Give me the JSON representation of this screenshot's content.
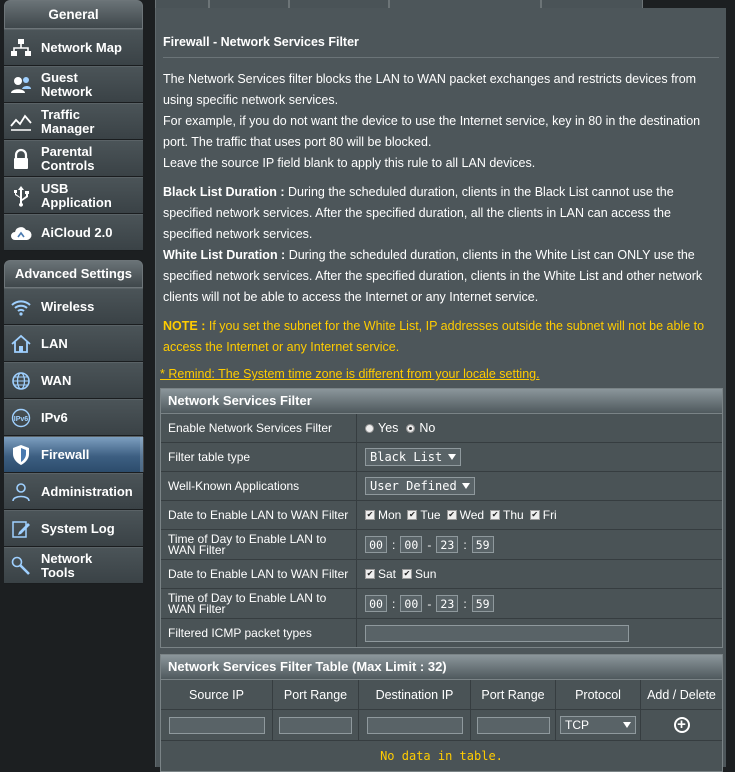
{
  "sidebar": {
    "general_title": "General",
    "general_items": [
      {
        "label": "Network Map",
        "icon": "network-map-icon"
      },
      {
        "label": "Guest\nNetwork",
        "icon": "guest-network-icon"
      },
      {
        "label": "Traffic\nManager",
        "icon": "traffic-manager-icon"
      },
      {
        "label": "Parental\nControls",
        "icon": "parental-controls-icon"
      },
      {
        "label": "USB\nApplication",
        "icon": "usb-application-icon"
      },
      {
        "label": "AiCloud 2.0",
        "icon": "aicloud-icon"
      }
    ],
    "advanced_title": "Advanced Settings",
    "advanced_items": [
      {
        "label": "Wireless",
        "icon": "wireless-icon"
      },
      {
        "label": "LAN",
        "icon": "lan-icon"
      },
      {
        "label": "WAN",
        "icon": "wan-icon"
      },
      {
        "label": "IPv6",
        "icon": "ipv6-icon"
      },
      {
        "label": "Firewall",
        "icon": "firewall-icon",
        "active": true
      },
      {
        "label": "Administration",
        "icon": "administration-icon"
      },
      {
        "label": "System Log",
        "icon": "system-log-icon"
      },
      {
        "label": "Network\nTools",
        "icon": "network-tools-icon"
      }
    ]
  },
  "page": {
    "title": "Firewall - Network Services Filter",
    "desc1": "The Network Services filter blocks the LAN to WAN packet exchanges and restricts devices from using specific network services.",
    "desc2": "For example, if you do not want the device to use the Internet service, key in 80 in the destination port. The traffic that uses port 80 will be blocked.",
    "desc3": "Leave the source IP field blank to apply this rule to all LAN devices.",
    "black_label": "Black List Duration :",
    "black_text": "During the scheduled duration, clients in the Black List cannot use the specified network services. After the specified duration, all the clients in LAN can access the specified network services.",
    "white_label": "White List Duration :",
    "white_text": "During the scheduled duration, clients in the White List can ONLY use the specified network services. After the specified duration, clients in the White List and other network clients will not be able to access the Internet or any Internet service.",
    "note_label": "NOTE :",
    "note_text": "If you set the subnet for the White List, IP addresses outside the subnet will not be able to access the Internet or any Internet service.",
    "remind": "* Remind: The System time zone is different from your locale setting."
  },
  "filter": {
    "header": "Network Services Filter",
    "enable_label": "Enable Network Services Filter",
    "yes": "Yes",
    "no": "No",
    "type_label": "Filter table type",
    "type_value": "Black List",
    "apps_label": "Well-Known Applications",
    "apps_value": "User Defined",
    "date_label": "Date to Enable LAN to WAN Filter",
    "weekdays": [
      "Mon",
      "Tue",
      "Wed",
      "Thu",
      "Fri"
    ],
    "time_label": "Time of Day to Enable LAN to WAN Filter",
    "time1": [
      "00",
      "00",
      "23",
      "59"
    ],
    "date2_label": "Date to Enable LAN to WAN Filter",
    "weekend": [
      "Sat",
      "Sun"
    ],
    "time2_label": "Time of Day to Enable LAN to WAN Filter",
    "time2": [
      "00",
      "00",
      "23",
      "59"
    ],
    "icmp_label": "Filtered ICMP packet types",
    "icmp_value": ""
  },
  "filter_table": {
    "header": "Network Services Filter Table (Max Limit : 32)",
    "columns": [
      "Source IP",
      "Port Range",
      "Destination IP",
      "Port Range",
      "Protocol",
      "Add / Delete"
    ],
    "protocol_value": "TCP",
    "empty_text": "No data in table."
  }
}
